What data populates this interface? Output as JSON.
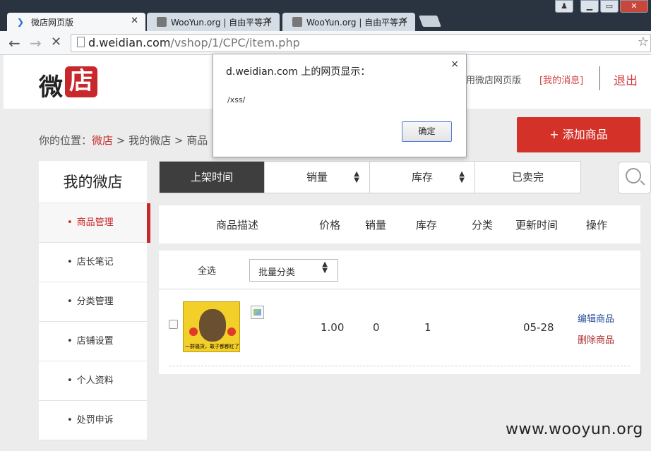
{
  "browser": {
    "tabs": [
      {
        "title": "微店网页版",
        "active": true
      },
      {
        "title": "WooYun.org | 自由平等开",
        "active": false
      },
      {
        "title": "WooYun.org | 自由平等开",
        "active": false
      }
    ],
    "url_host": "d.weidian.com",
    "url_path": "/vshop/1/CPC/item.php"
  },
  "header": {
    "logo_text": "微",
    "logo_box_text": "店",
    "link_web": "用微店网页版",
    "link_messages": "[我的消息]",
    "logout": "退出"
  },
  "breadcrumb": {
    "prefix": "你的位置：",
    "home": "微店",
    "sep1": " > ",
    "shop": "我的微店",
    "sep2": " > ",
    "current": "商品"
  },
  "add_button": "+ 添加商品",
  "sidebar": {
    "title": "我的微店",
    "items": [
      {
        "label": "商品管理",
        "active": true
      },
      {
        "label": "店长笔记",
        "active": false
      },
      {
        "label": "分类管理",
        "active": false
      },
      {
        "label": "店铺设置",
        "active": false
      },
      {
        "label": "个人资料",
        "active": false
      },
      {
        "label": "处罚申诉",
        "active": false
      }
    ],
    "bullet": "•"
  },
  "sort_tabs": [
    "上架时间",
    "销量",
    "库存",
    "已卖完"
  ],
  "columns": [
    "商品描述",
    "价格",
    "销量",
    "库存",
    "分类",
    "更新时间",
    "操作"
  ],
  "list": {
    "select_all": "全选",
    "batch_category": "批量分类",
    "items": [
      {
        "image_caption": "一群骚货，敢子都都红了",
        "price": "1.00",
        "sales": "0",
        "stock": "1",
        "updated": "05-28",
        "edit": "编辑商品",
        "delete": "删除商品"
      }
    ]
  },
  "dialog": {
    "title": "d.weidian.com 上的网页显示：",
    "message": "/xss/",
    "ok": "确定",
    "close": "×"
  },
  "watermark": "www.wooyun.org"
}
